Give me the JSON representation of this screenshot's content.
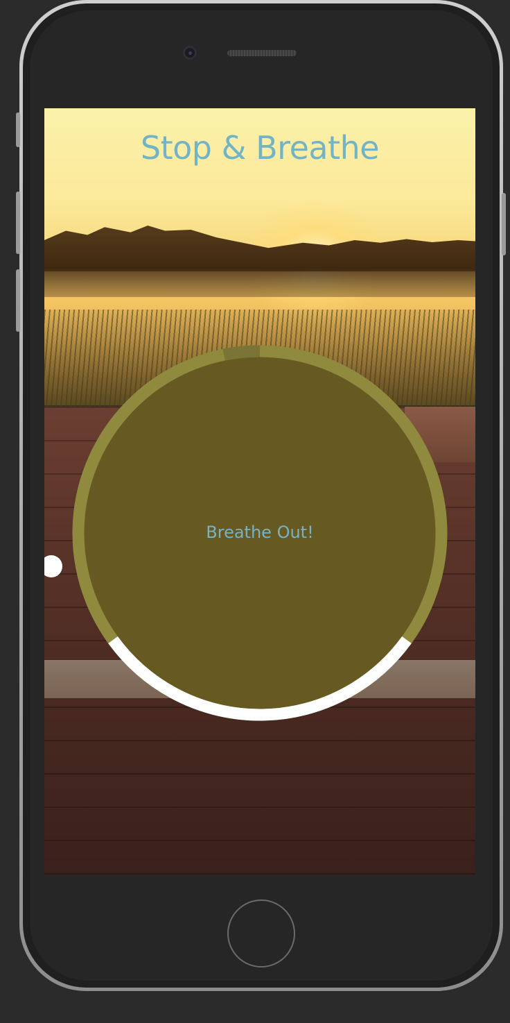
{
  "app": {
    "title": "Stop & Breathe"
  },
  "breathing": {
    "instruction": "Breathe Out!",
    "progress_fraction": 0.3,
    "colors": {
      "fill": "#665a22",
      "ring": "#8f8a3e",
      "progress": "#ffffff",
      "title_text": "#73b3c6"
    }
  },
  "icons": {
    "home_button": "home-button-circle",
    "camera": "front-camera",
    "speaker": "earpiece-speaker"
  }
}
